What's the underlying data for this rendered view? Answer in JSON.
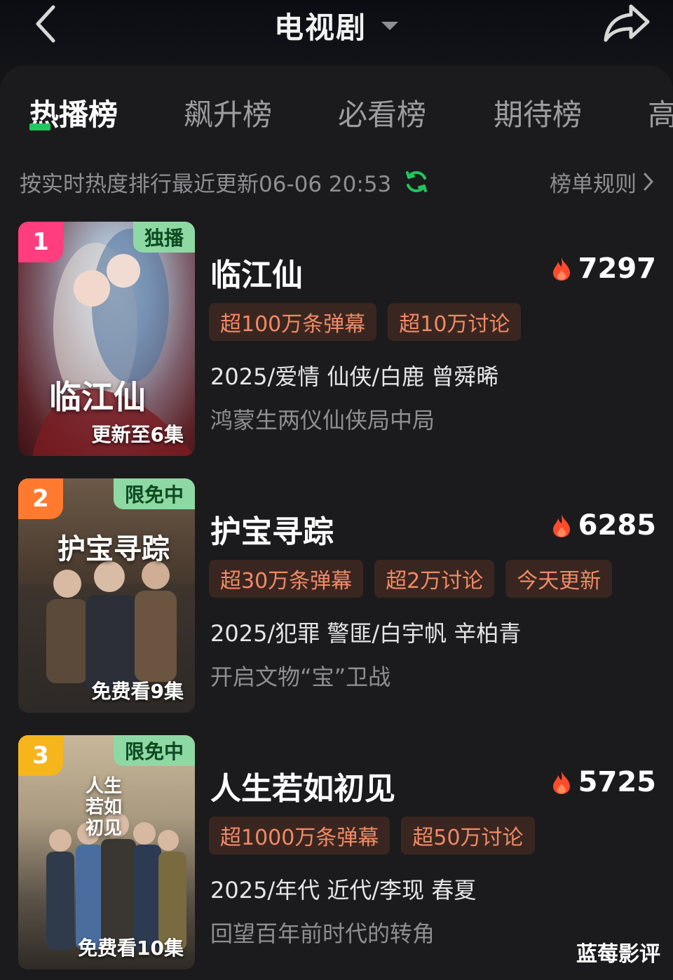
{
  "header": {
    "title": "电视剧",
    "back_icon": "chevron-left-icon",
    "dropdown_icon": "caret-down-icon",
    "share_icon": "share-icon"
  },
  "tabs": [
    {
      "label": "热播榜",
      "active": true
    },
    {
      "label": "飙升榜",
      "active": false
    },
    {
      "label": "必看榜",
      "active": false
    },
    {
      "label": "期待榜",
      "active": false
    },
    {
      "label": "高",
      "active": false
    }
  ],
  "subheader": {
    "update_text": "按实时热度排行最近更新06-06 20:53",
    "rules_label": "榜单规则"
  },
  "colors": {
    "accent_green": "#22c55e",
    "rank1": "#ff3d7f",
    "rank2": "#ff7a2e",
    "rank3": "#f5b51b",
    "pill_text": "#f08a66"
  },
  "items": [
    {
      "rank": "1",
      "badge": "独播",
      "poster_title": "临江仙",
      "poster_caption": "更新至6集",
      "title": "临江仙",
      "heat": "7297",
      "tags": [
        "超100万条弹幕",
        "超10万讨论"
      ],
      "meta": "2025/爱情 仙侠/白鹿 曾舜晞",
      "desc": "鸿蒙生两仪仙侠局中局"
    },
    {
      "rank": "2",
      "badge": "限免中",
      "poster_title": "护宝寻踪",
      "poster_caption": "免费看9集",
      "title": "护宝寻踪",
      "heat": "6285",
      "tags": [
        "超30万条弹幕",
        "超2万讨论",
        "今天更新"
      ],
      "meta": "2025/犯罪 警匪/白宇帆 辛柏青",
      "desc": "开启文物“宝”卫战"
    },
    {
      "rank": "3",
      "badge": "限免中",
      "poster_title": "人生若如初见",
      "poster_caption": "免费看10集",
      "title": "人生若如初见",
      "heat": "5725",
      "tags": [
        "超1000万条弹幕",
        "超50万讨论"
      ],
      "meta": "2025/年代 近代/李现 春夏",
      "desc": "回望百年前时代的转角"
    }
  ],
  "watermark": "蓝莓影评"
}
